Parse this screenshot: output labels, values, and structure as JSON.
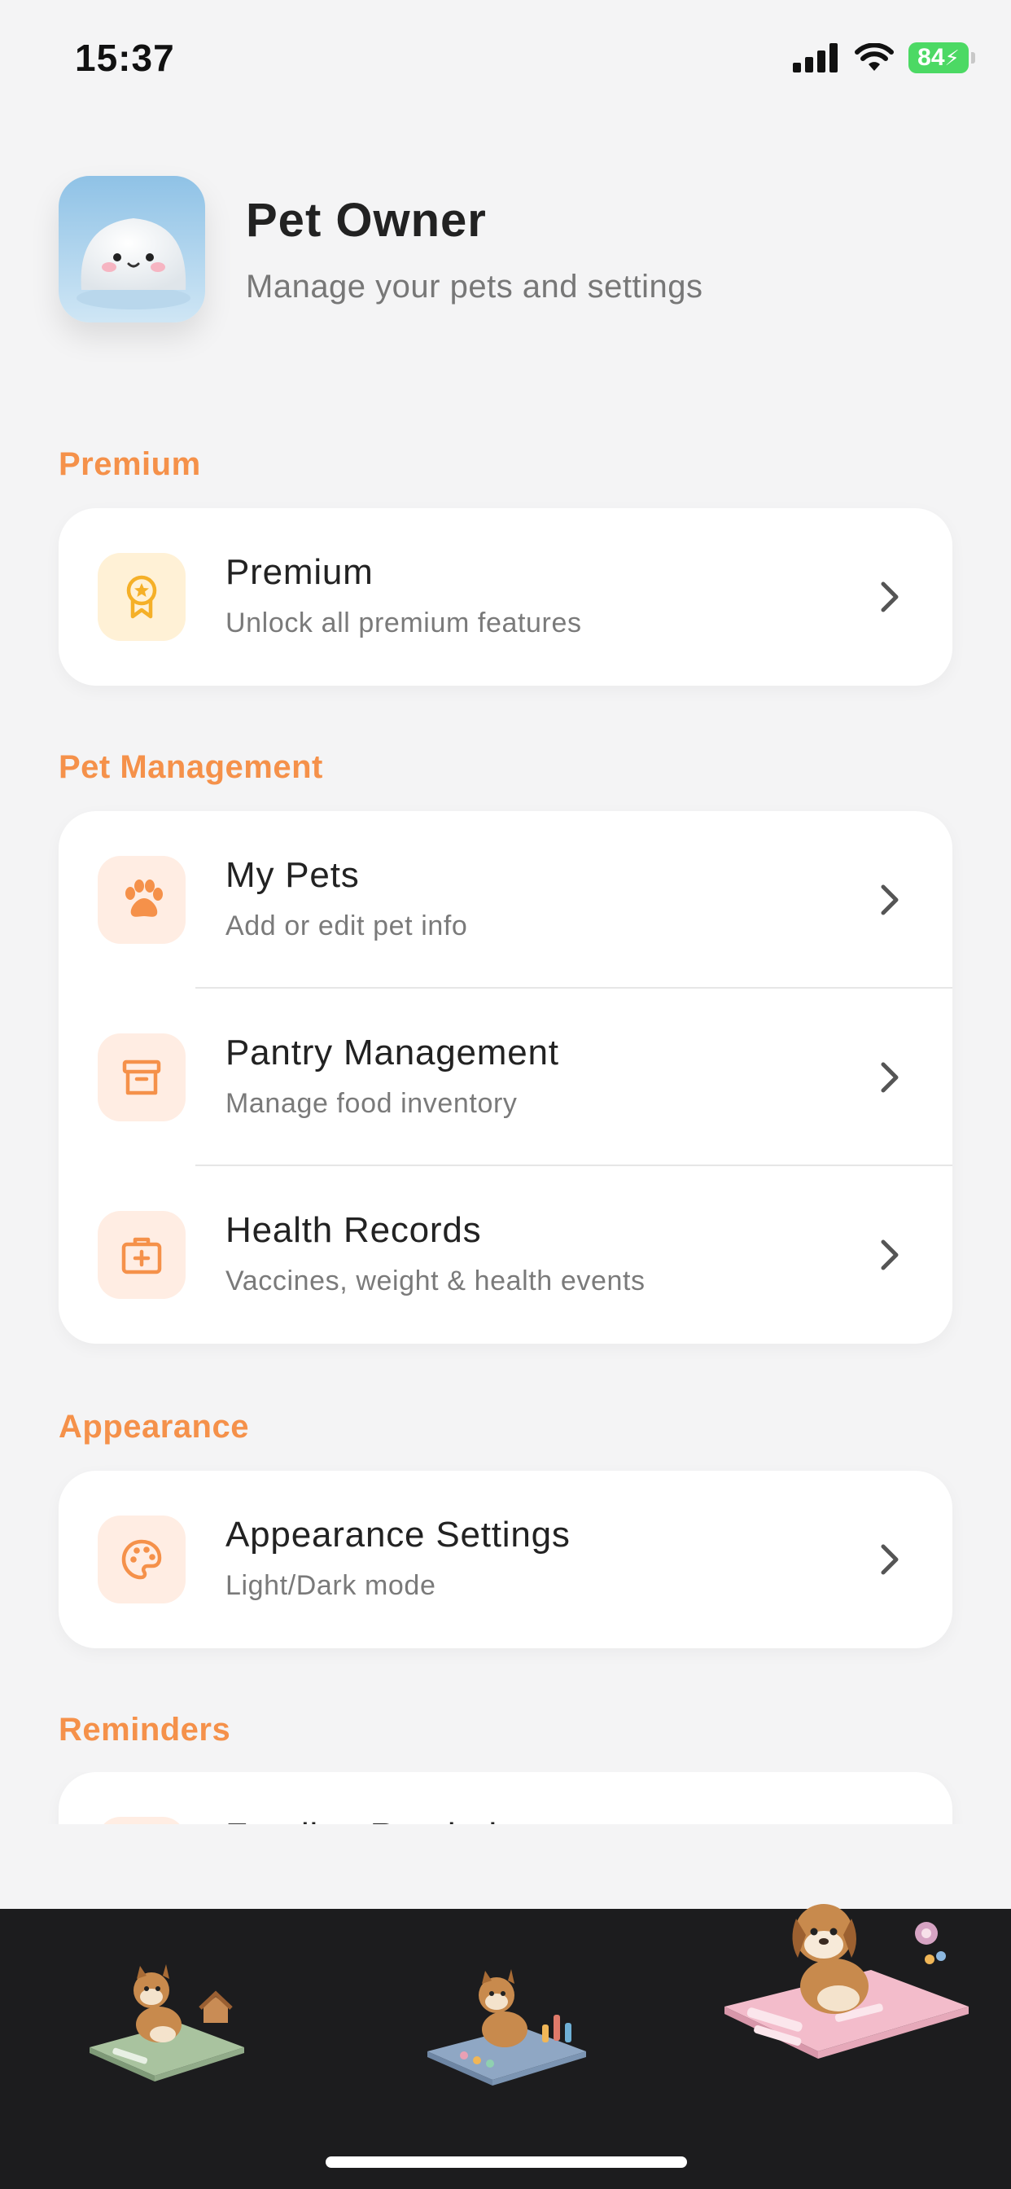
{
  "status": {
    "time": "15:37",
    "battery": "84"
  },
  "profile": {
    "name": "Pet Owner",
    "subtitle": "Manage your pets and settings"
  },
  "sections": {
    "premium": {
      "title": "Premium",
      "items": [
        {
          "title": "Premium",
          "subtitle": "Unlock all premium features",
          "icon": "ribbon-star-icon"
        }
      ]
    },
    "pet_management": {
      "title": "Pet Management",
      "items": [
        {
          "title": "My Pets",
          "subtitle": "Add or edit pet info",
          "icon": "paw-icon"
        },
        {
          "title": "Pantry Management",
          "subtitle": "Manage food inventory",
          "icon": "archive-box-icon"
        },
        {
          "title": "Health Records",
          "subtitle": "Vaccines, weight & health events",
          "icon": "medical-kit-icon"
        }
      ]
    },
    "appearance": {
      "title": "Appearance",
      "items": [
        {
          "title": "Appearance Settings",
          "subtitle": "Light/Dark mode",
          "icon": "palette-icon"
        }
      ]
    },
    "reminders": {
      "title": "Reminders",
      "items": [
        {
          "title": "Feeding Reminders",
          "subtitle": "",
          "icon": "bell-icon"
        }
      ]
    }
  },
  "tabs": [
    {
      "name": "home-tab",
      "icon": "dog-house-icon",
      "selected": false
    },
    {
      "name": "stats-tab",
      "icon": "dog-chart-icon",
      "selected": false
    },
    {
      "name": "profile-tab",
      "icon": "dog-settings-icon",
      "selected": true
    }
  ],
  "colors": {
    "accent": "#f5914a",
    "icon_bg": "#ffede3",
    "premium_icon_bg": "#fff1d6",
    "tab_bar": "#1c1c1e",
    "battery": "#4cd964"
  }
}
